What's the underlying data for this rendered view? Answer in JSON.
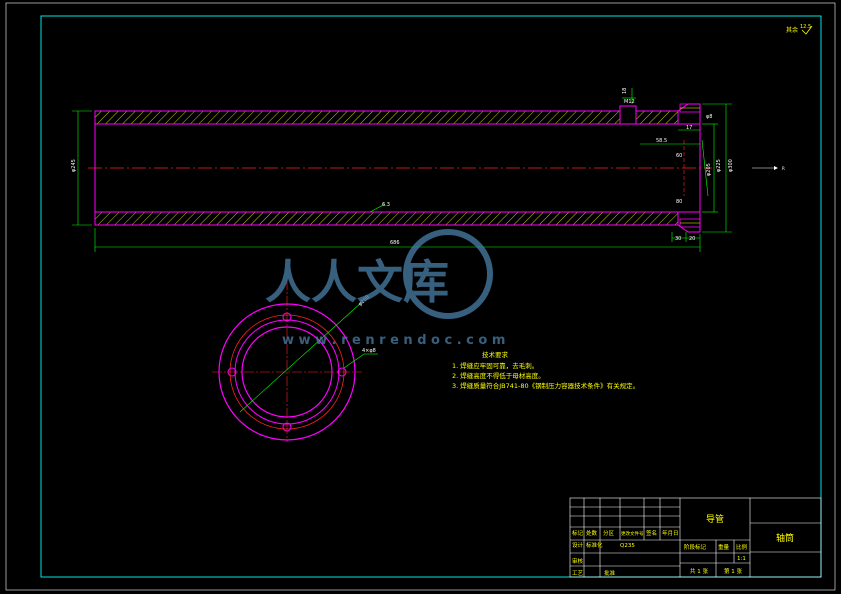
{
  "drawing": {
    "roughness_symbol": "其余",
    "roughness_value": "12.5",
    "section_mark": "R",
    "hole_note": "4×φ8"
  },
  "dimensions": {
    "overall_length": "686",
    "outer_diameter": "φ245",
    "bore_diameter": "φ205",
    "flange_diameter": "φ300",
    "counterbore_diameter": "φ225",
    "end_width": "17",
    "step_depth": "58.5",
    "end_offset_a": "30",
    "end_offset_b": "20",
    "small_hole": "φ8",
    "thread_mark": "M12",
    "slot_mark": "18",
    "roughness_body": "6.3",
    "pcd_circle": "φ258",
    "end_label_1": "60",
    "end_label_2": "80"
  },
  "tech_requirements": {
    "title": "技术要求",
    "items": [
      "1. 焊缝应牢固可靠，去毛刺。",
      "2. 焊缝高度不得低于母材高度。",
      "3. 焊缝质量符合JB741-80《钢制压力容器技术条件》有关规定。"
    ]
  },
  "watermark": {
    "chars": "人人文库",
    "url": "w w w . r e n r e n d o c . c o m"
  },
  "title_block": {
    "part_name": "导管",
    "material": "Q235",
    "scale_label": "比例",
    "scale_value": "1:1",
    "drawing_no": "轴筒",
    "sheet_total": "共 1 张",
    "sheet_no": "第 1 张",
    "designer_label": "设计",
    "checker_label": "审核",
    "process_label": "工艺",
    "standard_label": "标准化",
    "approve_label": "批准",
    "mark_label": "标记",
    "count_label": "处数",
    "zone_label": "分区",
    "change_no_label": "更改文件号",
    "signature_label": "签名",
    "date_label": "年月日",
    "weight_label": "重量",
    "stage_label": "阶段标记",
    "ratio_label": "比例"
  },
  "colors": {
    "frame": "#00e5e5",
    "outline": "#ff00ff",
    "dimension": "#00ff00",
    "centerline": "#ff2020",
    "hatch": "#c8c800",
    "note": "#ffff00",
    "hidden": "#ff4040",
    "watermark": "#4a7fa8"
  }
}
